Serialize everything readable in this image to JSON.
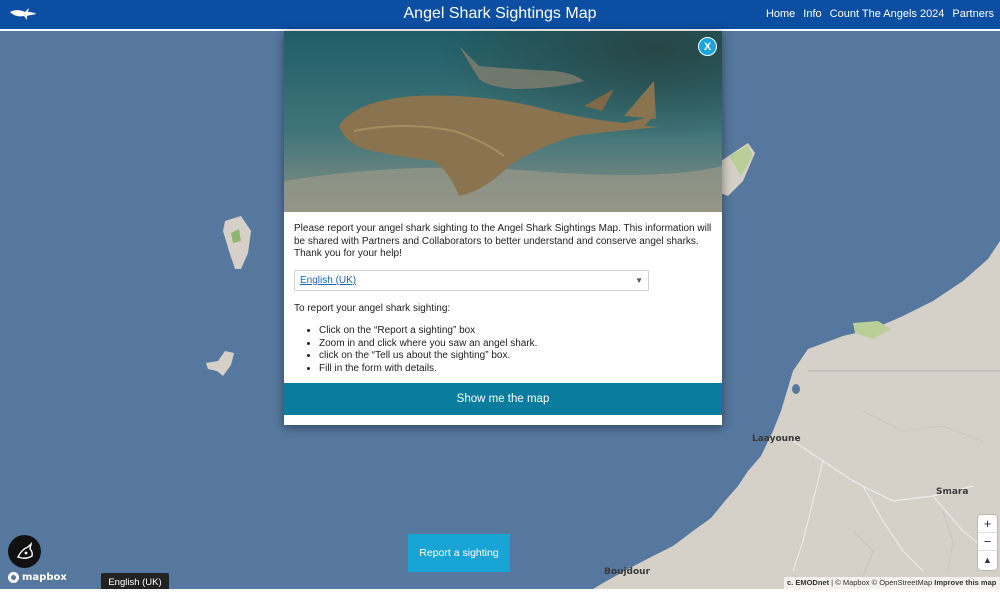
{
  "header": {
    "title": "Angel Shark Sightings Map",
    "nav": [
      "Home",
      "Info",
      "Count The Angels 2024",
      "Partners"
    ]
  },
  "modal": {
    "close_label": "X",
    "intro": "Please report your angel shark sighting to the Angel Shark Sightings Map. This information will be shared with Partners and Collaborators to better understand and conserve angel sharks. Thank you for your help!",
    "language_selected": "English (UK)",
    "report_heading": "To report your angel shark sighting:",
    "steps": [
      "Click on the “Report a sighting” box",
      "Zoom in and click where you saw an angel shark.",
      "click on the “Tell us about the sighting” box.",
      "Fill in the form with details."
    ],
    "show_map_label": "Show me the map"
  },
  "map": {
    "places": [
      "Laayoune",
      "Smara",
      "Boujdour"
    ],
    "report_button": "Report a sighting",
    "zoom_in": "+",
    "zoom_out": "−",
    "compass": "▲",
    "mapbox_label": "mapbox",
    "language_tooltip": "English (UK)",
    "attribution_bold": "c. EMODnet",
    "attribution_text": " | © Mapbox © OpenStreetMap ",
    "attribution_improve": "Improve this map"
  },
  "colors": {
    "header_bg": "#0b4ea2",
    "sea": "#56789e",
    "land": "#d6d1c8",
    "button_blue": "#19a4d6",
    "show_map_bg": "#0a7c9e"
  }
}
